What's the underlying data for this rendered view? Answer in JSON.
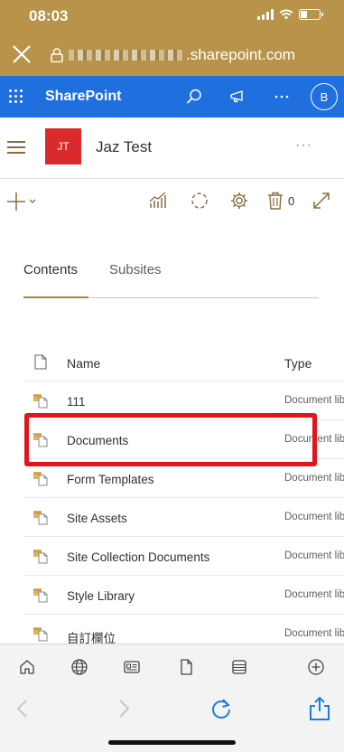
{
  "status": {
    "time": "08:03",
    "battery_level": 0.35
  },
  "browser": {
    "url_visible": ".sharepoint.com"
  },
  "suite": {
    "brand": "SharePoint",
    "avatar_initial": "B"
  },
  "site": {
    "logo_initials": "JT",
    "title": "Jaz Test",
    "more": "···"
  },
  "commands": {
    "recycle_count": "0"
  },
  "tabs": {
    "contents": "Contents",
    "subsites": "Subsites"
  },
  "list": {
    "columns": {
      "name": "Name",
      "type": "Type"
    },
    "rows": [
      {
        "name": "111",
        "type": "Document library"
      },
      {
        "name": "Documents",
        "type": "Document library"
      },
      {
        "name": "Form Templates",
        "type": "Document library"
      },
      {
        "name": "Site Assets",
        "type": "Document library"
      },
      {
        "name": "Site Collection Documents",
        "type": "Document library"
      },
      {
        "name": "Style Library",
        "type": "Document library"
      },
      {
        "name": "自訂欄位",
        "type": "Document library"
      }
    ]
  },
  "colors": {
    "brand_gold": "#b8934a",
    "suite_blue": "#1f6fde",
    "logo_red": "#d92b2b",
    "highlight_red": "#e3141b",
    "ios_blue": "#1a7cf0"
  }
}
